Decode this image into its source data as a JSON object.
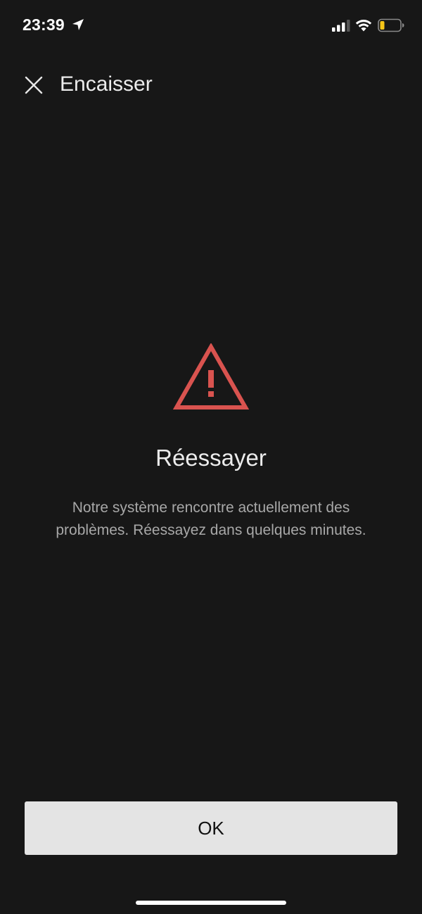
{
  "status_bar": {
    "time": "23:39"
  },
  "header": {
    "title": "Encaisser"
  },
  "error": {
    "title": "Réessayer",
    "message": "Notre système rencontre actuellement des problèmes. Réessayez dans quelques minutes."
  },
  "actions": {
    "ok_label": "OK"
  },
  "colors": {
    "background": "#171717",
    "warning": "#d9534f",
    "button_bg": "#e4e4e4",
    "battery_level": "#f5c518"
  },
  "icons": {
    "close": "close-icon",
    "warning": "warning-triangle-icon",
    "location": "location-arrow-icon",
    "signal": "cellular-signal-icon",
    "wifi": "wifi-icon",
    "battery": "battery-icon"
  }
}
